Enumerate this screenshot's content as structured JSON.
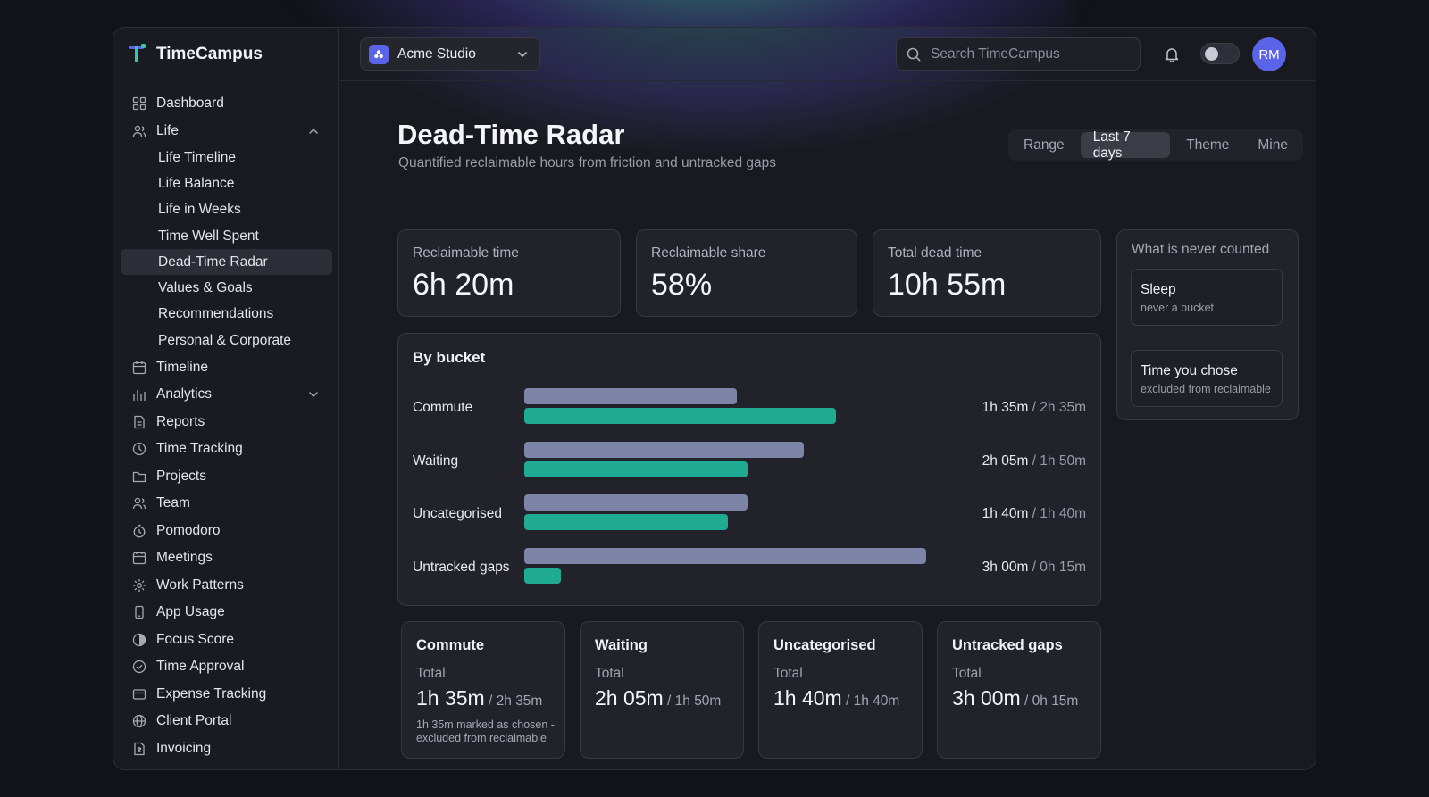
{
  "app": {
    "name": "TimeCampus"
  },
  "sidebar": {
    "items": [
      {
        "label": "Dashboard",
        "icon": "dashboard-icon"
      },
      {
        "label": "Life",
        "icon": "user-icon",
        "expanded": true
      },
      {
        "label": "Life Timeline",
        "sub": true
      },
      {
        "label": "Life Balance",
        "sub": true
      },
      {
        "label": "Life in Weeks",
        "sub": true
      },
      {
        "label": "Time Well Spent",
        "sub": true
      },
      {
        "label": "Dead-Time Radar",
        "sub": true,
        "active": true
      },
      {
        "label": "Values & Goals",
        "sub": true
      },
      {
        "label": "Recommendations",
        "sub": true
      },
      {
        "label": "Personal & Corporate",
        "sub": true
      },
      {
        "label": "Timeline",
        "icon": "calendar-icon"
      },
      {
        "label": "Analytics",
        "icon": "analytics-icon",
        "expanded": false
      },
      {
        "label": "Reports",
        "icon": "document-icon"
      },
      {
        "label": "Time Tracking",
        "icon": "clock-icon"
      },
      {
        "label": "Projects",
        "icon": "folder-icon"
      },
      {
        "label": "Team",
        "icon": "team-icon"
      },
      {
        "label": "Pomodoro",
        "icon": "timer-icon"
      },
      {
        "label": "Meetings",
        "icon": "calendar-icon"
      },
      {
        "label": "Work Patterns",
        "icon": "pattern-icon"
      },
      {
        "label": "App Usage",
        "icon": "phone-icon"
      },
      {
        "label": "Focus Score",
        "icon": "focus-icon"
      },
      {
        "label": "Time Approval",
        "icon": "check-circle-icon"
      },
      {
        "label": "Expense Tracking",
        "icon": "card-icon"
      },
      {
        "label": "Client Portal",
        "icon": "globe-icon"
      },
      {
        "label": "Invoicing",
        "icon": "invoice-icon"
      }
    ]
  },
  "topbar": {
    "workspace": "Acme Studio",
    "search_placeholder": "Search TimeCampus",
    "avatar_initials": "RM"
  },
  "page": {
    "title": "Dead-Time Radar",
    "subtitle": "Quantified reclaimable hours from friction and untracked gaps"
  },
  "filters": {
    "items": [
      "Range",
      "Last 7 days",
      "Theme",
      "Mine"
    ],
    "active": "Last 7 days"
  },
  "stats": [
    {
      "label": "Reclaimable time",
      "value": "6h 20m"
    },
    {
      "label": "Reclaimable share",
      "value": "58%"
    },
    {
      "label": "Total dead time",
      "value": "10h 55m"
    }
  ],
  "never_counted": {
    "title": "What is never counted",
    "items": [
      {
        "title": "Sleep",
        "subtitle": "never a bucket"
      },
      {
        "title": "Time you chose",
        "subtitle": "excluded from reclaimable"
      }
    ]
  },
  "by_bucket": {
    "title": "By bucket",
    "rows": [
      {
        "name": "Commute",
        "total": "1h 35m",
        "reclaimable": "2h 35m",
        "total_min": 95,
        "recl_min": 155
      },
      {
        "name": "Waiting",
        "total": "2h 05m",
        "reclaimable": "1h 50m",
        "total_min": 125,
        "recl_min": 110
      },
      {
        "name": "Uncategorised",
        "total": "1h 40m",
        "reclaimable": "1h 40m",
        "total_min": 100,
        "recl_min": 100
      },
      {
        "name": "Untracked gaps",
        "total": "3h 00m",
        "reclaimable": "0h 15m",
        "total_min": 180,
        "recl_min": 15
      }
    ]
  },
  "bucket_cards": [
    {
      "title": "Commute",
      "label": "Total",
      "a": "1h 35m",
      "b": "2h 35m",
      "note": "1h 35m marked as chosen - excluded from reclaimable"
    },
    {
      "title": "Waiting",
      "label": "Total",
      "a": "2h 05m",
      "b": "1h 50m",
      "note": ""
    },
    {
      "title": "Uncategorised",
      "label": "Total",
      "a": "1h 40m",
      "b": "1h 40m",
      "note": ""
    },
    {
      "title": "Untracked gaps",
      "label": "Total",
      "a": "3h 00m",
      "b": "0h 15m",
      "note": ""
    }
  ],
  "colors": {
    "accent": "#5b63e8",
    "bar_total": "#7d84a8",
    "bar_reclaimable": "#1faa92",
    "background": "#191a20"
  }
}
